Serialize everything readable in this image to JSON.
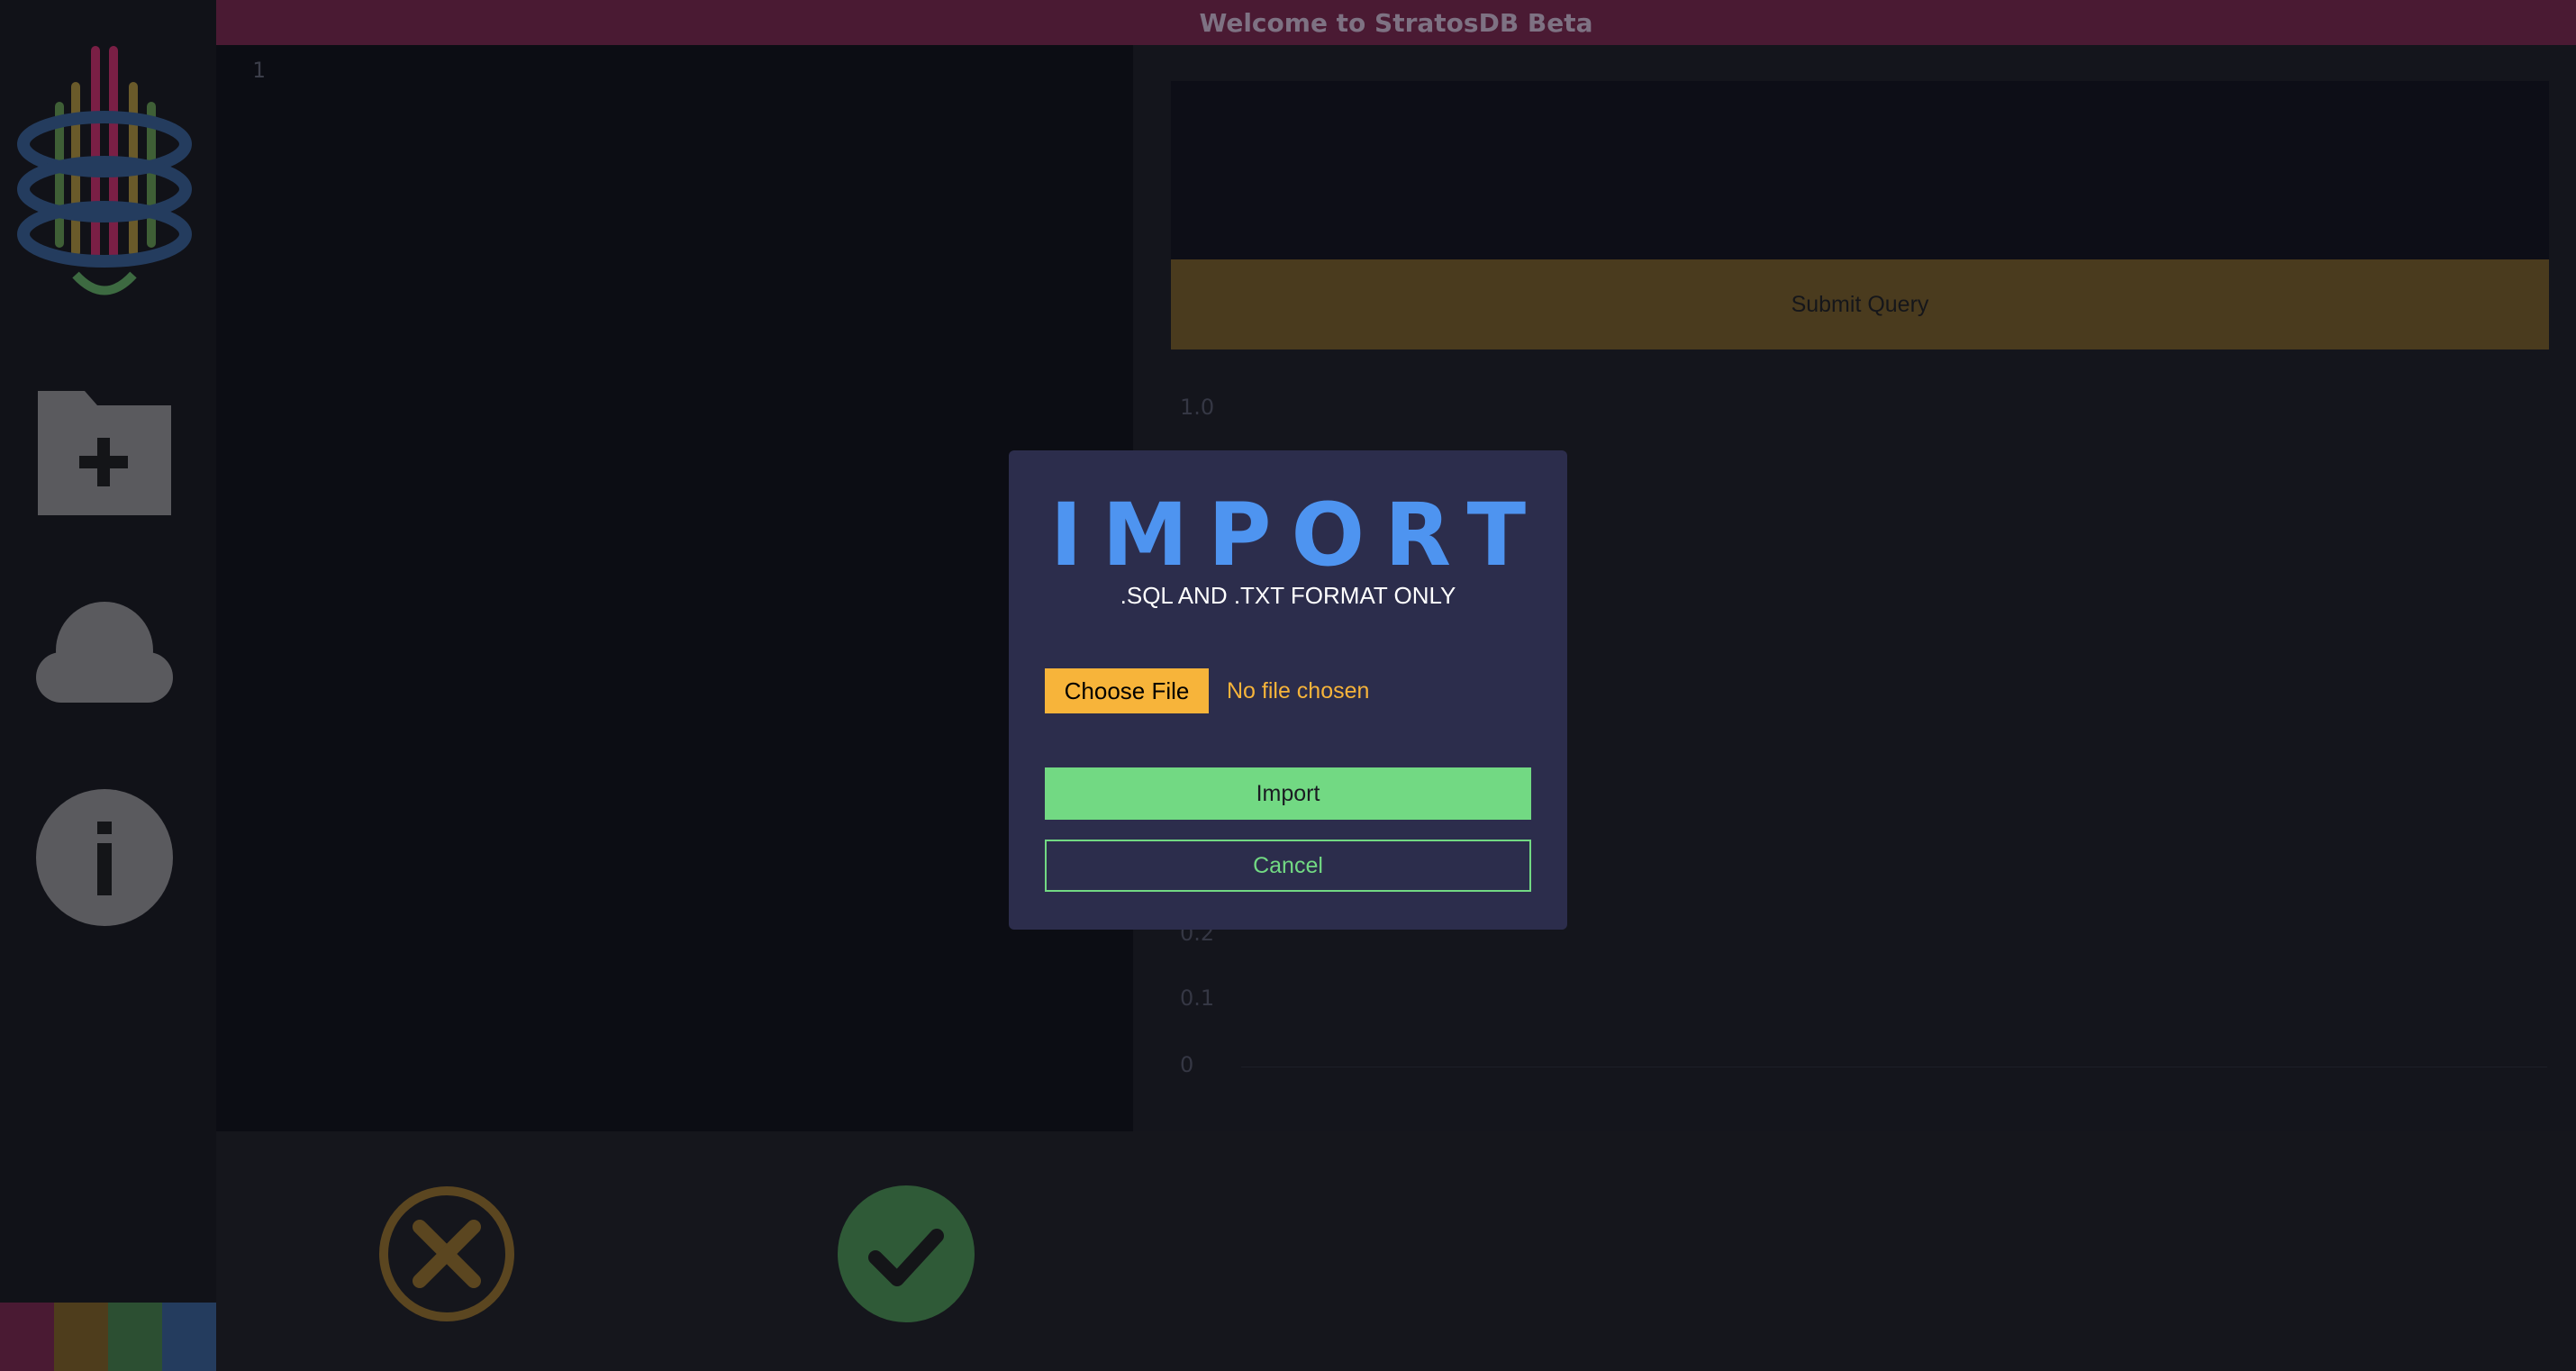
{
  "app": {
    "title": "Welcome to StratosDB Beta",
    "brand_colors": [
      "#7a1f45",
      "#4e3d1c",
      "#2c4f32",
      "#243c5e"
    ]
  },
  "sidebar": {
    "logo_icon": "stratosdb-database-logo",
    "items": [
      {
        "icon": "folder-plus-icon",
        "name": "new-folder"
      },
      {
        "icon": "cloud-icon",
        "name": "cloud"
      },
      {
        "icon": "info-icon",
        "name": "info"
      }
    ]
  },
  "editor": {
    "line_numbers": [
      "1"
    ],
    "content": ""
  },
  "query_panel": {
    "query_value": "",
    "submit_label": "Submit Query"
  },
  "chart_data": {
    "type": "bar",
    "title": "",
    "y_ticks_visible": [
      "1.0",
      "0.2",
      "0.1",
      "0"
    ],
    "values": []
  },
  "bottom_actions": [
    {
      "icon": "cancel-icon",
      "label": "cancel"
    },
    {
      "icon": "check-icon",
      "label": "confirm"
    }
  ],
  "modal": {
    "title": "IMPORT",
    "subtitle": ".SQL AND .TXT FORMAT ONLY",
    "choose_file_label": "Choose File",
    "file_status": "No file chosen",
    "import_label": "Import",
    "cancel_label": "Cancel"
  },
  "colors": {
    "modal_bg": "#2c2d4c",
    "accent_blue": "#4e94f0",
    "accent_orange": "#f7b43a",
    "accent_green": "#72d983"
  }
}
